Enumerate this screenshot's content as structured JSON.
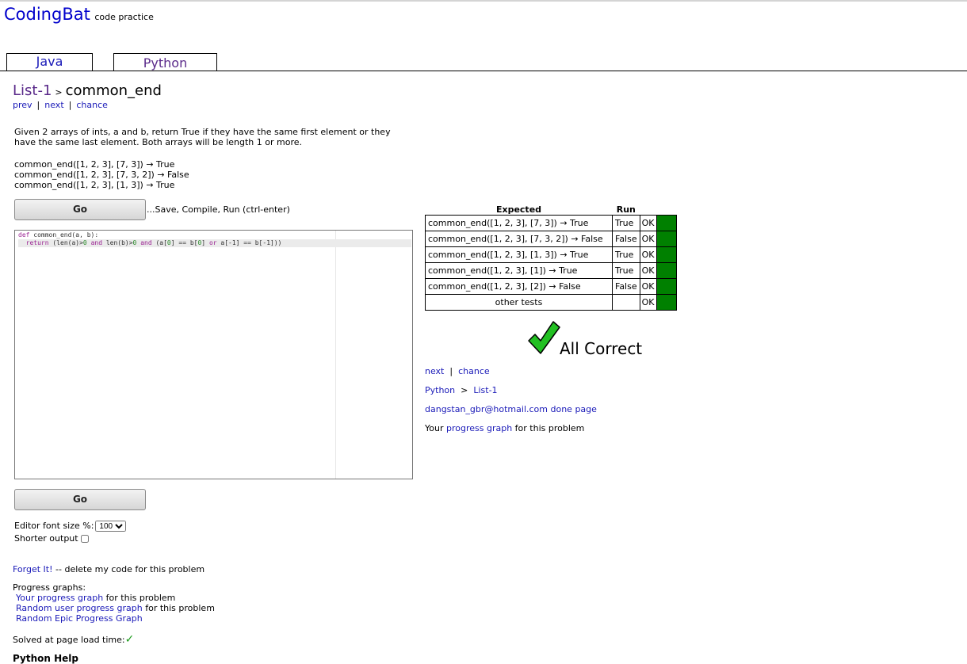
{
  "brand": {
    "name": "CodingBat",
    "tagline": "code practice"
  },
  "tabs": [
    {
      "label": "Java"
    },
    {
      "label": "Python"
    }
  ],
  "breadcrumb": {
    "section": "List-1",
    "separator": ">",
    "problem": "common_end"
  },
  "problem_nav": {
    "prev": "prev",
    "next": "next",
    "chance": "chance",
    "separator": "|"
  },
  "description": "Given 2 arrays of ints, a and b, return True if they have the same first element or they have the same last element. Both arrays will be length 1 or more.",
  "examples": [
    "common_end([1, 2, 3], [7, 3]) → True",
    "common_end([1, 2, 3], [7, 3, 2]) → False",
    "common_end([1, 2, 3], [1, 3]) → True"
  ],
  "go_button": "Go",
  "save_hint": "...Save, Compile, Run (ctrl-enter)",
  "editor": {
    "line1": {
      "kw": "def",
      "rest": " common_end(a, b):"
    },
    "line2": {
      "indent": "  ",
      "kw_return": "return",
      "p1": " (len(a)>",
      "n1": "0",
      "sp1": " ",
      "kw_and1": "and",
      "p2": " len(b)>",
      "n2": "0",
      "sp2": " ",
      "kw_and2": "and",
      "p3": " (a[",
      "n3": "0",
      "p4": "] == b[",
      "n4": "0",
      "p5": "] ",
      "kw_or": "or",
      "p6": " a[-1] == b[-1]))"
    }
  },
  "editor_font": {
    "label": "Editor font size %:",
    "value": "100"
  },
  "shorter_output": {
    "label": "Shorter output",
    "checked": false
  },
  "forget": {
    "link": "Forget It!",
    "text": " -- delete my code for this problem"
  },
  "progress_graphs": {
    "heading": "Progress graphs:",
    "your_link": "Your progress graph",
    "your_suffix": " for this problem",
    "random_user_link": "Random user progress graph",
    "random_user_suffix": " for this problem",
    "epic_link": "Random Epic Progress Graph"
  },
  "solved": {
    "label": "Solved at page load time:",
    "icon": "check-icon"
  },
  "results": {
    "headers": {
      "expected": "Expected",
      "run": "Run"
    },
    "rows": [
      {
        "expected": "common_end([1, 2, 3], [7, 3]) → True",
        "run": "True",
        "status": "OK"
      },
      {
        "expected": "common_end([1, 2, 3], [7, 3, 2]) → False",
        "run": "False",
        "status": "OK"
      },
      {
        "expected": "common_end([1, 2, 3], [1, 3]) → True",
        "run": "True",
        "status": "OK"
      },
      {
        "expected": "common_end([1, 2, 3], [1]) → True",
        "run": "True",
        "status": "OK"
      },
      {
        "expected": "common_end([1, 2, 3], [2]) → False",
        "run": "False",
        "status": "OK"
      },
      {
        "expected": "other tests",
        "run": "",
        "status": "OK"
      }
    ],
    "pass_color": "#008000"
  },
  "all_correct": {
    "text": "All Correct",
    "icon": "big-check-icon"
  },
  "after_nav": {
    "next": "next",
    "chance": "chance",
    "separator": "|"
  },
  "after_crumb": {
    "lang": "Python",
    "separator": ">",
    "section": "List-1"
  },
  "done_page": "dangstan_gbr@hotmail.com done page",
  "your_progress": {
    "prefix": "Your ",
    "link": "progress graph",
    "suffix": " for this problem"
  },
  "cut_off_heading": "Python Help",
  "colors": {
    "brand": "#0000cc",
    "link": "#1a1ab8",
    "visited": "#5a2a8a",
    "success": "#008000"
  }
}
